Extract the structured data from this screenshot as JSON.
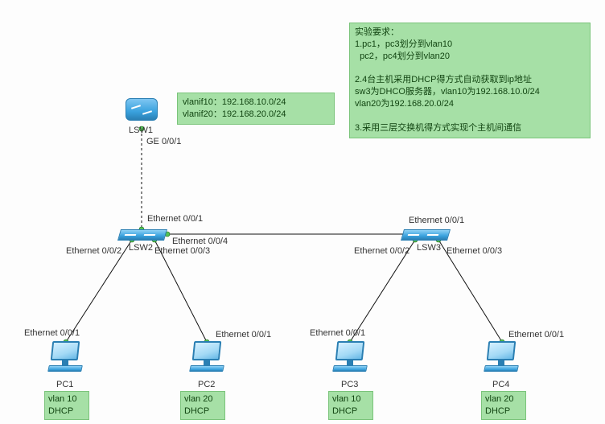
{
  "vlan_note": {
    "line1": "vlanif10：192.168.10.0/24",
    "line2": "vlanif20：192.168.20.0/24"
  },
  "requirements": {
    "title": "实验要求：",
    "r1a": "1.pc1，pc3划分到vlan10",
    "r1b": "  pc2，pc4划分到vlan20",
    "r2a": "2.4台主机采用DHCP得方式自动获取到ip地址",
    "r2b": "sw3为DHCO服务器，vlan10为192.168.10.0/24",
    "r2c": "vlan20为192.168.20.0/24",
    "r3": "3.采用三层交换机得方式实现个主机间通信"
  },
  "devices": {
    "lsw1": "LSW1",
    "lsw2": "LSW2",
    "lsw3": "LSW3",
    "pc1": "PC1",
    "pc2": "PC2",
    "pc3": "PC3",
    "pc4": "PC4"
  },
  "pc_notes": {
    "pc1_l1": "vlan 10",
    "pc1_l2": "DHCP",
    "pc2_l1": "vlan 20",
    "pc2_l2": "DHCP",
    "pc3_l1": "vlan 10",
    "pc3_l2": "DHCP",
    "pc4_l1": "vlan 20",
    "pc4_l2": "DHCP"
  },
  "ports": {
    "lsw1_ge001": "GE 0/0/1",
    "lsw2_e001": "Ethernet 0/0/1",
    "lsw2_e002": "Ethernet 0/0/2",
    "lsw2_e003": "Ethernet 0/0/3",
    "lsw2_e004": "Ethernet 0/0/4",
    "lsw3_e001": "Ethernet 0/0/1",
    "lsw3_e002": "Ethernet 0/0/2",
    "lsw3_e003": "Ethernet 0/0/3",
    "pc1_e001": "Ethernet 0/0/1",
    "pc2_e001": "Ethernet 0/0/1",
    "pc3_e001": "Ethernet 0/0/1",
    "pc4_e001": "Ethernet 0/0/1"
  },
  "topology": {
    "links": [
      {
        "from": "LSW1 GE0/0/1",
        "to": "LSW2 Ethernet0/0/1",
        "style": "dashed"
      },
      {
        "from": "LSW2 Ethernet0/0/4",
        "to": "LSW3 Ethernet0/0/1",
        "style": "solid"
      },
      {
        "from": "LSW2 Ethernet0/0/2",
        "to": "PC1 Ethernet0/0/1",
        "style": "solid"
      },
      {
        "from": "LSW2 Ethernet0/0/3",
        "to": "PC2 Ethernet0/0/1",
        "style": "solid"
      },
      {
        "from": "LSW3 Ethernet0/0/2",
        "to": "PC3 Ethernet0/0/1",
        "style": "solid"
      },
      {
        "from": "LSW3 Ethernet0/0/3",
        "to": "PC4 Ethernet0/0/1",
        "style": "solid"
      }
    ]
  }
}
